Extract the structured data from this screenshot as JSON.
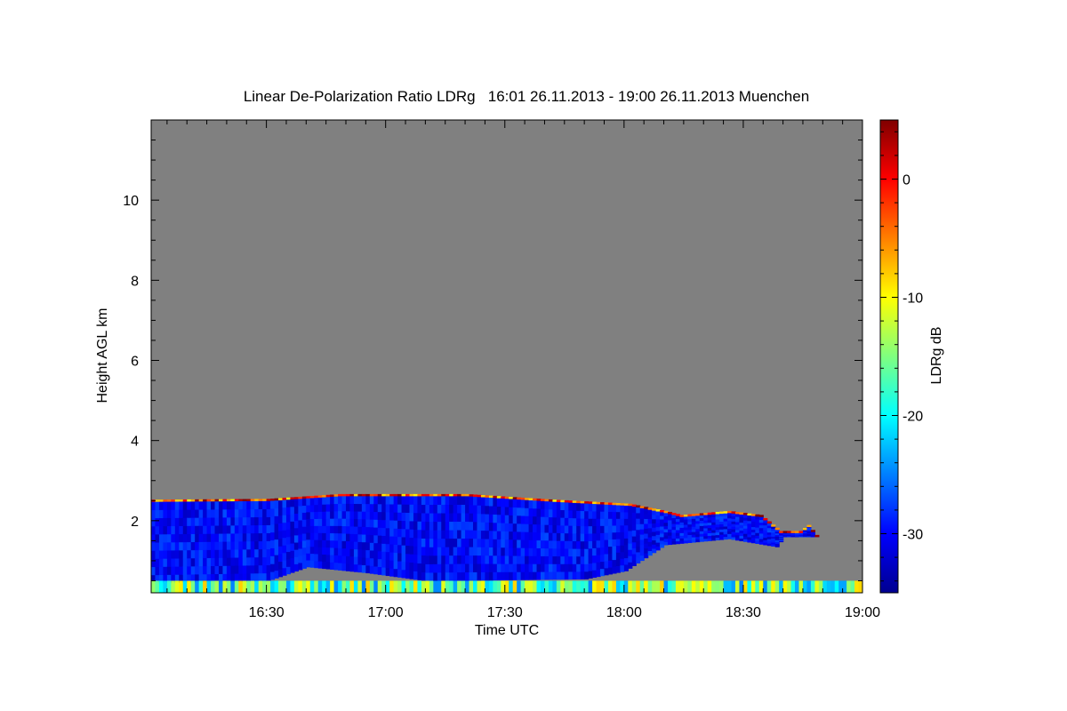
{
  "chart_data": {
    "type": "heatmap",
    "title": "Linear De-Polarization Ratio LDRg   16:01 26.11.2013 - 19:00 26.11.2013 Muenchen",
    "xlabel": "Time UTC",
    "ylabel": "Height AGL km",
    "colorbar_label": "LDRg dB",
    "x_range_minutes_utc": [
      961,
      1140
    ],
    "y_range_km": [
      0.2,
      12.0
    ],
    "x_ticks": [
      {
        "t": 990,
        "label": "16:30"
      },
      {
        "t": 1020,
        "label": "17:00"
      },
      {
        "t": 1050,
        "label": "17:30"
      },
      {
        "t": 1080,
        "label": "18:00"
      },
      {
        "t": 1110,
        "label": "18:30"
      },
      {
        "t": 1140,
        "label": "19:00"
      }
    ],
    "y_ticks": [
      {
        "v": 2,
        "label": "2"
      },
      {
        "v": 4,
        "label": "4"
      },
      {
        "v": 6,
        "label": "6"
      },
      {
        "v": 8,
        "label": "8"
      },
      {
        "v": 10,
        "label": "10"
      }
    ],
    "color_range_db": [
      -35,
      5
    ],
    "colorbar_ticks": [
      {
        "v": 0,
        "label": "0"
      },
      {
        "v": -10,
        "label": "-10"
      },
      {
        "v": -20,
        "label": "-20"
      },
      {
        "v": -30,
        "label": "-30"
      }
    ],
    "background_color": "#808080",
    "cloud_top_km": [
      {
        "t": 961,
        "top": 2.48
      },
      {
        "t": 990,
        "top": 2.5
      },
      {
        "t": 1008,
        "top": 2.62
      },
      {
        "t": 1040,
        "top": 2.62
      },
      {
        "t": 1062,
        "top": 2.48
      },
      {
        "t": 1081,
        "top": 2.38
      },
      {
        "t": 1090,
        "top": 2.2
      },
      {
        "t": 1094,
        "top": 2.1
      },
      {
        "t": 1106,
        "top": 2.2
      },
      {
        "t": 1114,
        "top": 2.1
      },
      {
        "t": 1119,
        "top": 1.7
      },
      {
        "t": 1124,
        "top": 1.7
      },
      {
        "t": 1126,
        "top": 1.85
      },
      {
        "t": 1128,
        "top": 1.6
      }
    ],
    "cloud_base_km": [
      {
        "t": 961,
        "base": 0.45
      },
      {
        "t": 990,
        "base": 0.5
      },
      {
        "t": 1000,
        "base": 0.85
      },
      {
        "t": 1015,
        "base": 0.7
      },
      {
        "t": 1030,
        "base": 0.5
      },
      {
        "t": 1070,
        "base": 0.55
      },
      {
        "t": 1080,
        "base": 0.75
      },
      {
        "t": 1090,
        "base": 1.4
      },
      {
        "t": 1106,
        "base": 1.55
      },
      {
        "t": 1118,
        "base": 1.35
      },
      {
        "t": 1120,
        "base": 1.6
      }
    ],
    "cloud_ldr_db": -30,
    "ground_layer": {
      "top_km": 0.5,
      "ldr_db_range": [
        -25,
        -8
      ]
    },
    "top_edge_ldr_db": -2
  }
}
